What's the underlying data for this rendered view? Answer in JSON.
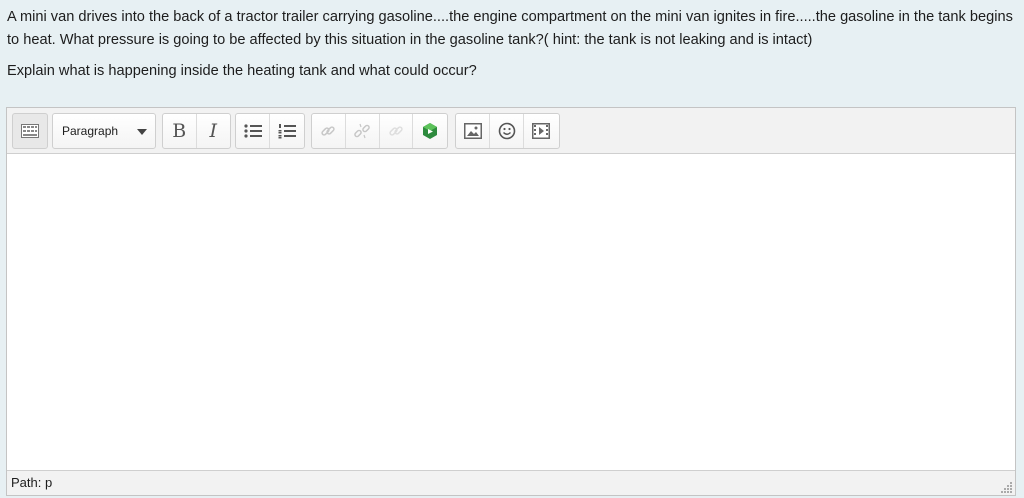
{
  "question": {
    "line1": "A mini van drives into the back of a tractor trailer carrying gasoline....the engine compartment on the mini van ignites in fire.....the gasoline in the tank begins to heat. What pressure is going to be affected by this situation in the gasoline tank?( hint: the tank is not leaking and is intact)",
    "line2": "Explain what is happening inside the heating tank and what could occur?"
  },
  "editor": {
    "format_select": "Paragraph",
    "bold_label": "B",
    "italic_label": "I",
    "status_path": "Path: p",
    "icons": [
      "toolbar-toggle-icon",
      "bulleted-list-icon",
      "numbered-list-icon",
      "link-icon",
      "unlink-icon",
      "anchor-icon",
      "media-icon",
      "image-icon",
      "emoticon-icon",
      "video-icon"
    ]
  }
}
